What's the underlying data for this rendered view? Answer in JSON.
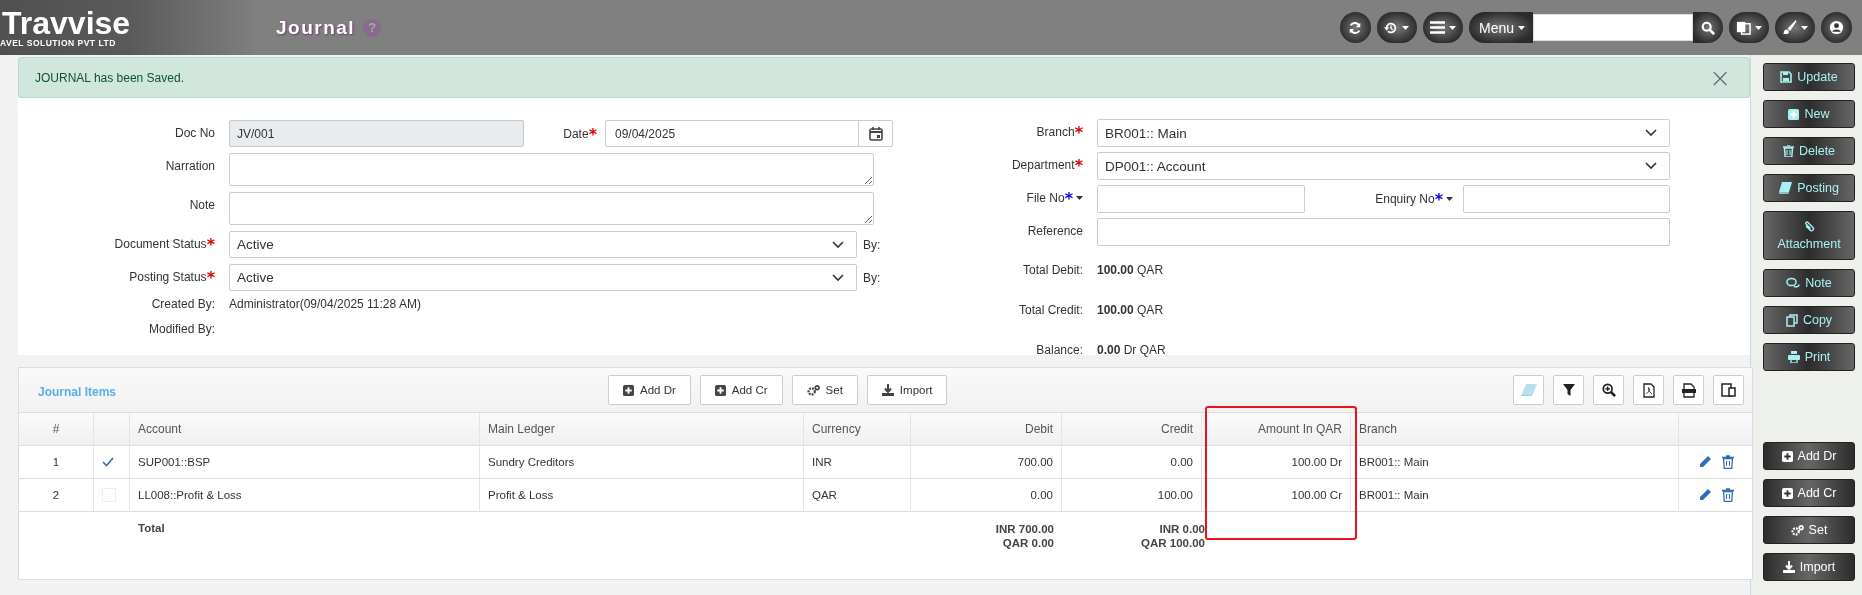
{
  "header": {
    "logo": "Travvise",
    "logo_subtitle": "AVEL SOLUTION PVT LTD",
    "title": "Journal",
    "help": "?",
    "menu_label": "Menu"
  },
  "alert": {
    "message": "JOURNAL has been Saved.",
    "close": "×"
  },
  "form": {
    "left": [
      {
        "kind": "text",
        "label": "Doc No",
        "value": "JV/001",
        "disabled": true,
        "extra": {
          "label": "Date",
          "marker": {
            "text": "*",
            "color": "#e00000"
          },
          "value": "09/04/2025"
        }
      },
      {
        "kind": "textarea",
        "label": "Narration"
      },
      {
        "kind": "textarea",
        "label": "Note"
      },
      {
        "kind": "select",
        "label": "Document Status",
        "marker": {
          "text": "*",
          "color": "#e00000"
        },
        "value": "Active",
        "suffix": "By:"
      },
      {
        "kind": "select",
        "label": "Posting Status",
        "marker": {
          "text": "*",
          "color": "#e00000"
        },
        "value": "Active",
        "suffix": "By:"
      },
      {
        "kind": "info",
        "label": "Created By:",
        "value": "Administrator(09/04/2025 11:28 AM)"
      },
      {
        "kind": "info",
        "label": "Modified By:"
      }
    ],
    "right": [
      {
        "kind": "select",
        "label": "Branch",
        "marker": {
          "text": "*",
          "color": "#e00000"
        },
        "value": "BR001:: Main"
      },
      {
        "kind": "select",
        "label": "Department",
        "marker": {
          "text": "*",
          "color": "#e00000"
        },
        "value": "DP001:: Account"
      },
      {
        "kind": "pair",
        "label": "File No",
        "marker": {
          "text": "*",
          "color": "#0000ee"
        },
        "has_menu": true,
        "extra": {
          "label": "Enquiry No",
          "marker": {
            "text": "*",
            "color": "#0000ee"
          },
          "has_menu": true
        }
      },
      {
        "kind": "text",
        "label": "Reference"
      },
      {
        "kind": "info",
        "label": "Total Debit:",
        "value": "**100.00** QAR"
      },
      {
        "kind": "info",
        "label": "Total Credit:",
        "value": "**100.00** QAR"
      },
      {
        "kind": "info",
        "label": "Balance:",
        "value": "**0.00** Dr QAR"
      }
    ]
  },
  "table": {
    "title": "Journal Items",
    "buttons": [
      "Add Dr",
      "Add Cr",
      "Set",
      "Import"
    ],
    "columns": [
      {
        "label": "#",
        "highlighted": false
      },
      {
        "highlighted": false
      },
      {
        "label": "Account",
        "highlighted": false
      },
      {
        "label": "Main Ledger",
        "highlighted": false
      },
      {
        "label": "Currency",
        "highlighted": false
      },
      {
        "label": "Debit",
        "highlighted": false
      },
      {
        "label": "Credit",
        "highlighted": false
      },
      {
        "label": "Amount In QAR",
        "highlighted": true
      },
      {
        "label": "Branch",
        "highlighted": false
      }
    ],
    "rows": [
      {
        "no": "1",
        "checked": true,
        "account": "SUP001::BSP",
        "ledger": "Sundry Creditors",
        "currency": "INR",
        "debit": "700.00",
        "credit": "0.00",
        "amount": "100.00 Dr",
        "branch": "BR001:: Main"
      },
      {
        "no": "2",
        "checked": false,
        "account": "LL008::Profit & Loss",
        "ledger": "Profit & Loss",
        "currency": "QAR",
        "debit": "0.00",
        "credit": "100.00",
        "amount": "100.00 Cr",
        "branch": "BR001:: Main"
      }
    ],
    "total": {
      "label": "Total",
      "debit": [
        "INR 700.00",
        "QAR 0.00"
      ],
      "credit": [
        "INR 0.00",
        "QAR 100.00"
      ]
    }
  },
  "sidebar": [
    {
      "kind": "record",
      "label": "Update"
    },
    {
      "kind": "record",
      "label": "New"
    },
    {
      "kind": "record",
      "label": "Delete"
    },
    {
      "kind": "record",
      "label": "Posting"
    },
    {
      "kind": "record",
      "label": "Attachment"
    },
    {
      "kind": "record",
      "label": "Note"
    },
    {
      "kind": "record",
      "label": "Copy"
    },
    {
      "kind": "record",
      "label": "Print"
    },
    {
      "kind": "grid",
      "label": "Add Dr"
    },
    {
      "kind": "grid",
      "label": "Add Cr"
    },
    {
      "kind": "grid",
      "label": "Set"
    },
    {
      "kind": "grid",
      "label": "Import"
    }
  ]
}
